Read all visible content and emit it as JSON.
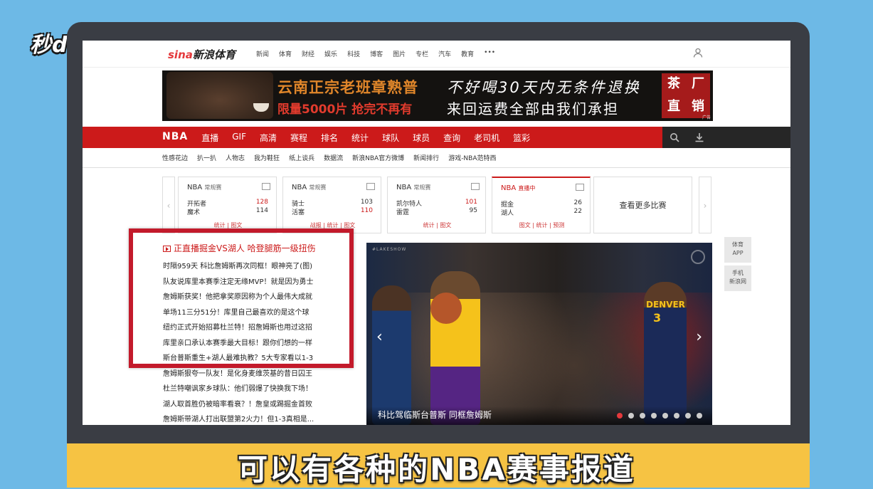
{
  "watermark": "秒dong视频",
  "caption": "可以有各种的NBA赛事报道",
  "site": {
    "logo_prefix": "sina",
    "logo_text": "新浪体育",
    "top_nav": [
      "新闻",
      "体育",
      "财经",
      "娱乐",
      "科技",
      "博客",
      "图片",
      "专栏",
      "汽车",
      "教育",
      "•••"
    ]
  },
  "ad": {
    "line1": "云南正宗老班章熟普",
    "line2": "限量5000片 抢完不再有",
    "line3": "不好喝30天内无条件退换",
    "line4": "来回运费全部由我们承担",
    "badge": [
      "茶",
      "厂",
      "直",
      "销"
    ],
    "tag": "广告"
  },
  "red_nav": [
    "NBA",
    "直播",
    "GIF",
    "高清",
    "赛程",
    "排名",
    "统计",
    "球队",
    "球员",
    "查询",
    "老司机",
    "篮彩"
  ],
  "sub_nav": [
    "性感花边",
    "扒一扒",
    "人物志",
    "我为鞋狂",
    "纸上谈兵",
    "数据流",
    "新浪NBA官方微博",
    "新闻排行",
    "游戏-NBA范特西"
  ],
  "games": [
    {
      "league": "NBA",
      "status": "常规赛",
      "team1": "开拓者",
      "score1": "128",
      "team2": "魔术",
      "score2": "114",
      "links": "统计 | 图文"
    },
    {
      "league": "NBA",
      "status": "常规赛",
      "team1": "骑士",
      "score1": "103",
      "team2": "活塞",
      "score2": "110",
      "links": "战报 | 统计 | 图文"
    },
    {
      "league": "NBA",
      "status": "常规赛",
      "team1": "凯尔特人",
      "score1": "101",
      "team2": "雷霆",
      "score2": "95",
      "links": "统计 | 图文"
    },
    {
      "league": "NBA",
      "status": "直播中",
      "team1": "掘金",
      "score1": "26",
      "team2": "湖人",
      "score2": "22",
      "links": "图文 | 统计 | 预测"
    }
  ],
  "more_games": "查看更多比赛",
  "side_widgets": [
    [
      "体育",
      "APP"
    ],
    [
      "手机",
      "新浪网"
    ]
  ],
  "headline": "正直播掘金VS湖人 哈登腿筋一级扭伤",
  "news": [
    "时隔959天 科比詹姆斯再次同框！眼神亮了(图)",
    "队友说库里本赛季注定无缘MVP！就是因为勇士",
    "詹姆斯获奖！他把拿奖原因称为个人最伟大成就",
    "单场11三分51分！库里自己最喜欢的是这个球",
    "纽约正式开始招募杜兰特！招詹姆斯也用过这招",
    "库里亲口承认本赛季最大目标！跟你们想的一样",
    "斯台普斯重生+湖人最难执教？5大专家看以1-3",
    "詹姆斯狠夸一队友！是化身麦维茨基的昔日囚王",
    "杜兰特嘲讽家乡球队：他们弱爆了快换我下场！",
    "湖人取首胜仍被暗率看衰？！詹皇或踢掘金首败",
    "詹姆斯带湖人打出联盟第2火力！但1-3真相是..."
  ],
  "slider": {
    "tag": "#LAKESHOW",
    "caption": "科比驾临斯台普斯 同框詹姆斯",
    "jersey_text": "DENVER",
    "jersey_number": "3",
    "dots": 8,
    "active_dot": 1
  },
  "colors": {
    "accent": "#cc1a1a",
    "frame_highlight": "#c31a2b",
    "caption_bar": "#f6c343",
    "background": "#6db9e6"
  }
}
